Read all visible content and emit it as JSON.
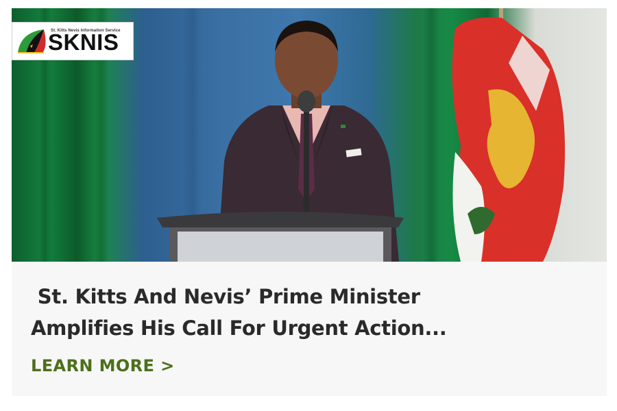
{
  "logo": {
    "tagline": "St. Kitts Nevis Information Service",
    "name": "SKNIS"
  },
  "article": {
    "headline": " St. Kitts And Nevis’ Prime Minister\nAmplifies His Call For Urgent Action...",
    "cta_label": "LEARN MORE >"
  },
  "colors": {
    "card_background": "#f7f7f7",
    "headline": "#2a2a2a",
    "cta": "#4c6f1a"
  }
}
